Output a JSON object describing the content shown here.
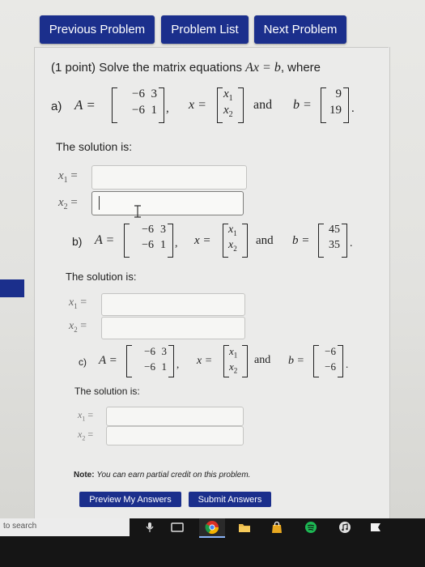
{
  "nav": {
    "previous": "Previous Problem",
    "list": "Problem List",
    "next": "Next Problem"
  },
  "problem": {
    "points": "(1 point) Solve the matrix equations",
    "equation": "Ax = b",
    "where": ", where"
  },
  "symbols": {
    "A_eq": "A =",
    "x_eq": "x =",
    "b_eq": "b =",
    "and": "and",
    "comma": ",",
    "period": ".",
    "x1": "x",
    "sub1": "1",
    "sub2": "2",
    "equals": "="
  },
  "parts": [
    {
      "label": "a)",
      "A": [
        [
          "−6",
          "3"
        ],
        [
          "−6",
          "1"
        ]
      ],
      "b": [
        "9",
        "19"
      ],
      "solution_label": "The solution is:",
      "x1_value": "",
      "x2_value": ""
    },
    {
      "label": "b)",
      "A": [
        [
          "−6",
          "3"
        ],
        [
          "−6",
          "1"
        ]
      ],
      "b": [
        "45",
        "35"
      ],
      "solution_label": "The solution is:",
      "x1_value": "",
      "x2_value": ""
    },
    {
      "label": "c)",
      "A": [
        [
          "−6",
          "3"
        ],
        [
          "−6",
          "1"
        ]
      ],
      "b": [
        "−6",
        "−6"
      ],
      "solution_label": "The solution is:",
      "x1_value": "",
      "x2_value": ""
    }
  ],
  "note": {
    "label": "Note:",
    "text": "You can earn partial credit on this problem."
  },
  "actions": {
    "preview": "Preview My Answers",
    "submit": "Submit Answers"
  },
  "taskbar": {
    "search_text": "to search"
  },
  "colors": {
    "nav_blue": "#1b2f8c",
    "chrome_red": "#d93025",
    "spotify_green": "#1db954",
    "store_gold": "#e8a820"
  }
}
